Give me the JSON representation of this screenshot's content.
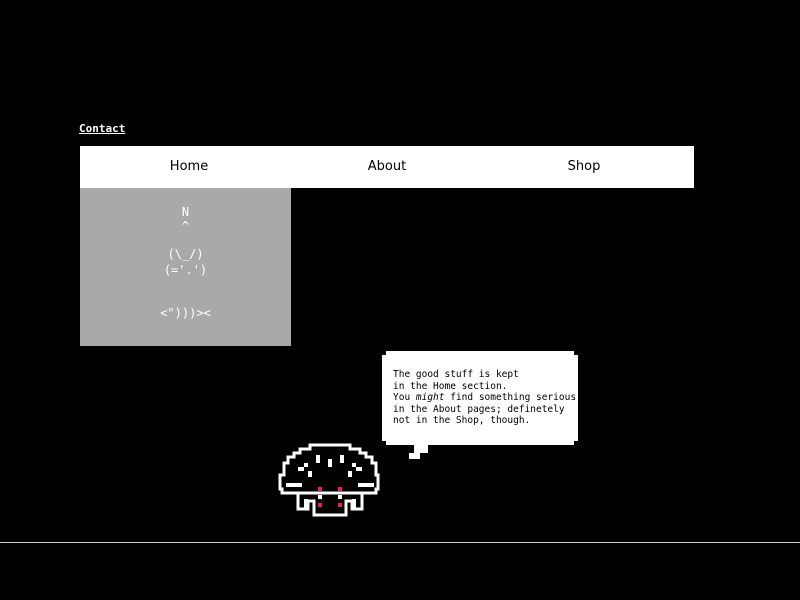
{
  "header": {
    "contact_link": "Contact"
  },
  "nav": {
    "items": [
      {
        "label": "Home"
      },
      {
        "label": "About"
      },
      {
        "label": "Shop"
      }
    ]
  },
  "ascii_art": {
    "lines": [
      "N",
      "^",
      "(\\_/)",
      "(='.')",
      "<\")))><"
    ]
  },
  "speech_bubble": {
    "line1": "The good stuff is kept",
    "line2": "in the Home section.",
    "line3_prefix": "You ",
    "line3_emphasis": "might",
    "line3_suffix": " find something serious",
    "line4": "in the About pages; definetely",
    "line5": "not in the Shop, though."
  },
  "mascot": {
    "icon": "mushroom-creature-icon",
    "accent_color": "#e0245e"
  },
  "colors": {
    "background": "#000000",
    "nav_background": "#ffffff",
    "art_panel": "#a9a9a9"
  }
}
